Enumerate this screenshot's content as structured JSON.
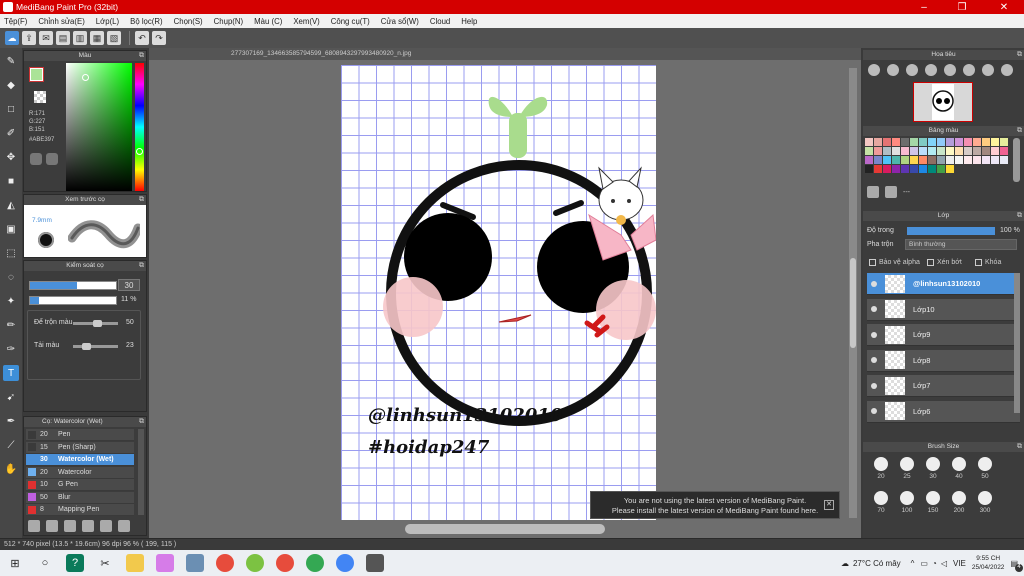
{
  "app": {
    "title": "MediBang Paint Pro (32bit)"
  },
  "menu": [
    "Tệp(F)",
    "Chỉnh sửa(E)",
    "Lớp(L)",
    "Bộ lọc(R)",
    "Chọn(S)",
    "Chụp(N)",
    "Màu (C)",
    "Xem(V)",
    "Công cụ(T)",
    "Cửa sổ(W)",
    "Cloud",
    "Help"
  ],
  "document": {
    "tab_title": "277307169_134663585794599_6808943297993480920_n.jpg"
  },
  "canvas_art": {
    "watermark1": "@linhsun13102010",
    "watermark2": "#hoidap247"
  },
  "color_panel": {
    "title": "Màu",
    "r": "R:171",
    "g": "G:227",
    "b": "B:151",
    "hex": "#ABE397",
    "fg_color": "#abe397"
  },
  "brush_preview": {
    "title": "Xem trước cọ",
    "size": "7.9mm"
  },
  "brush_control": {
    "title": "Kiểm soát cọ",
    "size_value": "30",
    "size_fill": 0.55,
    "opacity_value": "11 %",
    "opacity_fill": 0.11,
    "mix_label": "Để trộn màu",
    "mix_value": "50",
    "mix_level": 0.5,
    "refill_label": "Tải màu",
    "refill_value": "23",
    "refill_level": 0.23
  },
  "brush_list": {
    "title": "Cọ: Watercolor (Wet)",
    "items": [
      {
        "num": "20",
        "name": "Pen",
        "color": "#3a3a3a",
        "sel": false
      },
      {
        "num": "15",
        "name": "Pen (Sharp)",
        "color": "#3a3a3a",
        "sel": false
      },
      {
        "num": "30",
        "name": "Watercolor (Wet)",
        "color": "#4a90d9",
        "sel": true
      },
      {
        "num": "20",
        "name": "Watercolor",
        "color": "#6fb0ee",
        "sel": false
      },
      {
        "num": "10",
        "name": "G Pen",
        "color": "#e03030",
        "sel": false
      },
      {
        "num": "50",
        "name": "Blur",
        "color": "#c060e0",
        "sel": false
      },
      {
        "num": "8",
        "name": "Mapping Pen",
        "color": "#e03030",
        "sel": false
      }
    ]
  },
  "navigator": {
    "title": "Hoa tiêu"
  },
  "palette": {
    "title": "Bảng màu",
    "footer": "---",
    "colors": [
      "#f4c7c3",
      "#e7a7a0",
      "#e57373",
      "#ff8a80",
      "#6d6d6d",
      "#a5d6a7",
      "#80cbc4",
      "#81d4fa",
      "#90caf9",
      "#b39ddb",
      "#ce93d8",
      "#f48fb1",
      "#ffab91",
      "#ffcc80",
      "#fff59d",
      "#e6ee9c",
      "#c5e1a5",
      "#ef9a9a",
      "#b0bec5",
      "#e0e0e0",
      "#f8bbd0",
      "#d1c4e9",
      "#bbdefb",
      "#b2ebf2",
      "#c8e6c9",
      "#fff9c4",
      "#ffe0b2",
      "#d7ccc8",
      "#bcaaa4",
      "#a1887f",
      "#ffcdd2",
      "#f06292",
      "#ba68c8",
      "#7986cb",
      "#4fc3f7",
      "#4db6ac",
      "#aed581",
      "#ffd54f",
      "#ff8a65",
      "#8d6e63",
      "#90a4ae",
      "#eeeeee",
      "#f5f5f5",
      "#ffebee",
      "#fce4ec",
      "#f3e5f5",
      "#ede7f6",
      "#e8eaf6",
      "#222222",
      "#e53935",
      "#d81b60",
      "#8e24aa",
      "#5e35b1",
      "#3949ab",
      "#1e88e5",
      "#00897b",
      "#43a047",
      "#fdd835"
    ]
  },
  "layers": {
    "title": "Lớp",
    "opacity_label": "Độ trong",
    "opacity_value": "100 %",
    "opacity": 1.0,
    "blend_label": "Pha trộn",
    "blend_value": "Bình thường",
    "protect_alpha": "Bảo vệ alpha",
    "clip": "Xén bớt",
    "lock": "Khóa",
    "items": [
      {
        "name": "@linhsun13102010",
        "sel": true
      },
      {
        "name": "Lớp10",
        "sel": false
      },
      {
        "name": "Lớp9",
        "sel": false
      },
      {
        "name": "Lớp8",
        "sel": false
      },
      {
        "name": "Lớp7",
        "sel": false
      },
      {
        "name": "Lớp6",
        "sel": false
      }
    ]
  },
  "brush_size": {
    "title": "Brush Size",
    "values": [
      "20",
      "25",
      "30",
      "40",
      "50",
      "70",
      "100",
      "150",
      "200",
      "300"
    ]
  },
  "notification": {
    "line1": "You are not using the latest version of MediBang Paint.",
    "line2": "Please install the latest version of MediBang Paint found here."
  },
  "status": {
    "text": "512 * 740 pixel  (13.5 * 19.6cm)  96 dpi  96 %  ( 199, 115 )"
  },
  "taskbar": {
    "weather": "27°C  Có mây",
    "lang": "VIE",
    "time": "9:55 CH",
    "date": "25/04/2022",
    "notif_count": "4"
  }
}
